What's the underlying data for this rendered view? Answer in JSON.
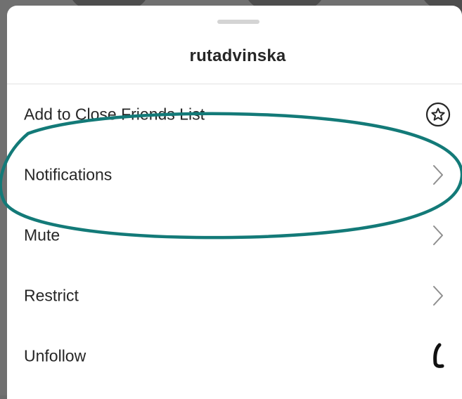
{
  "sheet": {
    "title": "rutadvinska"
  },
  "menu": {
    "items": [
      {
        "label": "Add to Close Friends List",
        "icon": "star-circle-icon"
      },
      {
        "label": "Notifications",
        "icon": "chevron-right-icon"
      },
      {
        "label": "Mute",
        "icon": "chevron-right-icon"
      },
      {
        "label": "Restrict",
        "icon": "chevron-right-icon"
      },
      {
        "label": "Unfollow",
        "icon": "hand-drawn-mark"
      }
    ]
  },
  "annotation": {
    "shape": "ellipse",
    "color": "#137a78",
    "highlights": "Notifications"
  },
  "colors": {
    "text": "#262626",
    "icon": "#8e8e8e",
    "divider": "#e2e2e2"
  }
}
